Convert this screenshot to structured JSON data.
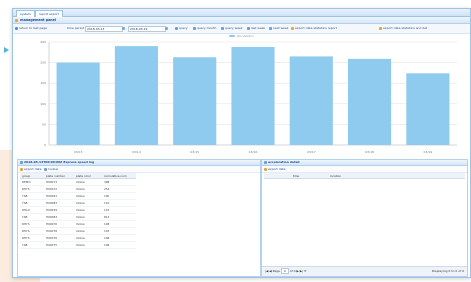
{
  "tabs": [
    "system",
    "report export"
  ],
  "panel_title": "management panel",
  "toolbar": {
    "return_label": "return to last page",
    "time_period_label": "time period",
    "start_date": "2018-03-13",
    "end_date": "2018-03-19",
    "buttons": [
      "query",
      "query month",
      "query week",
      "last week",
      "next week",
      "export data statistics report",
      "export data statistics and det"
    ]
  },
  "chart_legend": "data statistics",
  "chart_data": {
    "type": "bar",
    "categories": [
      "03/13",
      "03/14",
      "03/15",
      "03/16",
      "03/17",
      "03/18",
      "03/19"
    ],
    "values": [
      200,
      240,
      213,
      238,
      215,
      209,
      174
    ],
    "ylim": [
      0,
      250
    ],
    "yticks": [
      0,
      50,
      100,
      150,
      200,
      250
    ],
    "grid": true,
    "bar_color": "#8ecbee"
  },
  "left_panel": {
    "title": "2018-03-13T00:00:00Z Express speed log",
    "actions": [
      "export data",
      "lookup"
    ],
    "columns": [
      "group",
      "plate number",
      "plate color",
      "cumulative num"
    ],
    "rows": [
      [
        "DEMO",
        "H00073",
        "Yellow",
        "398"
      ],
      [
        "RHYS",
        "H00072",
        "Yellow",
        "254"
      ],
      [
        "YSB",
        "H00061",
        "Yellow",
        "100"
      ],
      [
        "YSB",
        "H00083",
        "Yellow",
        "110"
      ],
      [
        "RHLD",
        "H00039",
        "Yellow",
        "115"
      ],
      [
        "YSB",
        "H00083",
        "Yellow",
        "813"
      ],
      [
        "RHYS",
        "H00076",
        "Yellow",
        "108"
      ],
      [
        "RHYS",
        "H00078",
        "Yellow",
        "103"
      ],
      [
        "RHYS",
        "H00076",
        "Yellow",
        "108"
      ],
      [
        "YSB",
        "H00075",
        "Yellow",
        "108"
      ]
    ]
  },
  "right_panel": {
    "title": "acceleration detail",
    "action": "export data",
    "columns": [
      "time",
      "location"
    ],
    "pager": {
      "page_label": "Page",
      "page": "0",
      "of_label": "of 0",
      "display": "Displaying 0 to 0 of 0"
    }
  },
  "colors": {
    "accent": "#15428b",
    "bar": "#8ecbee",
    "border": "#9fc3e7"
  }
}
